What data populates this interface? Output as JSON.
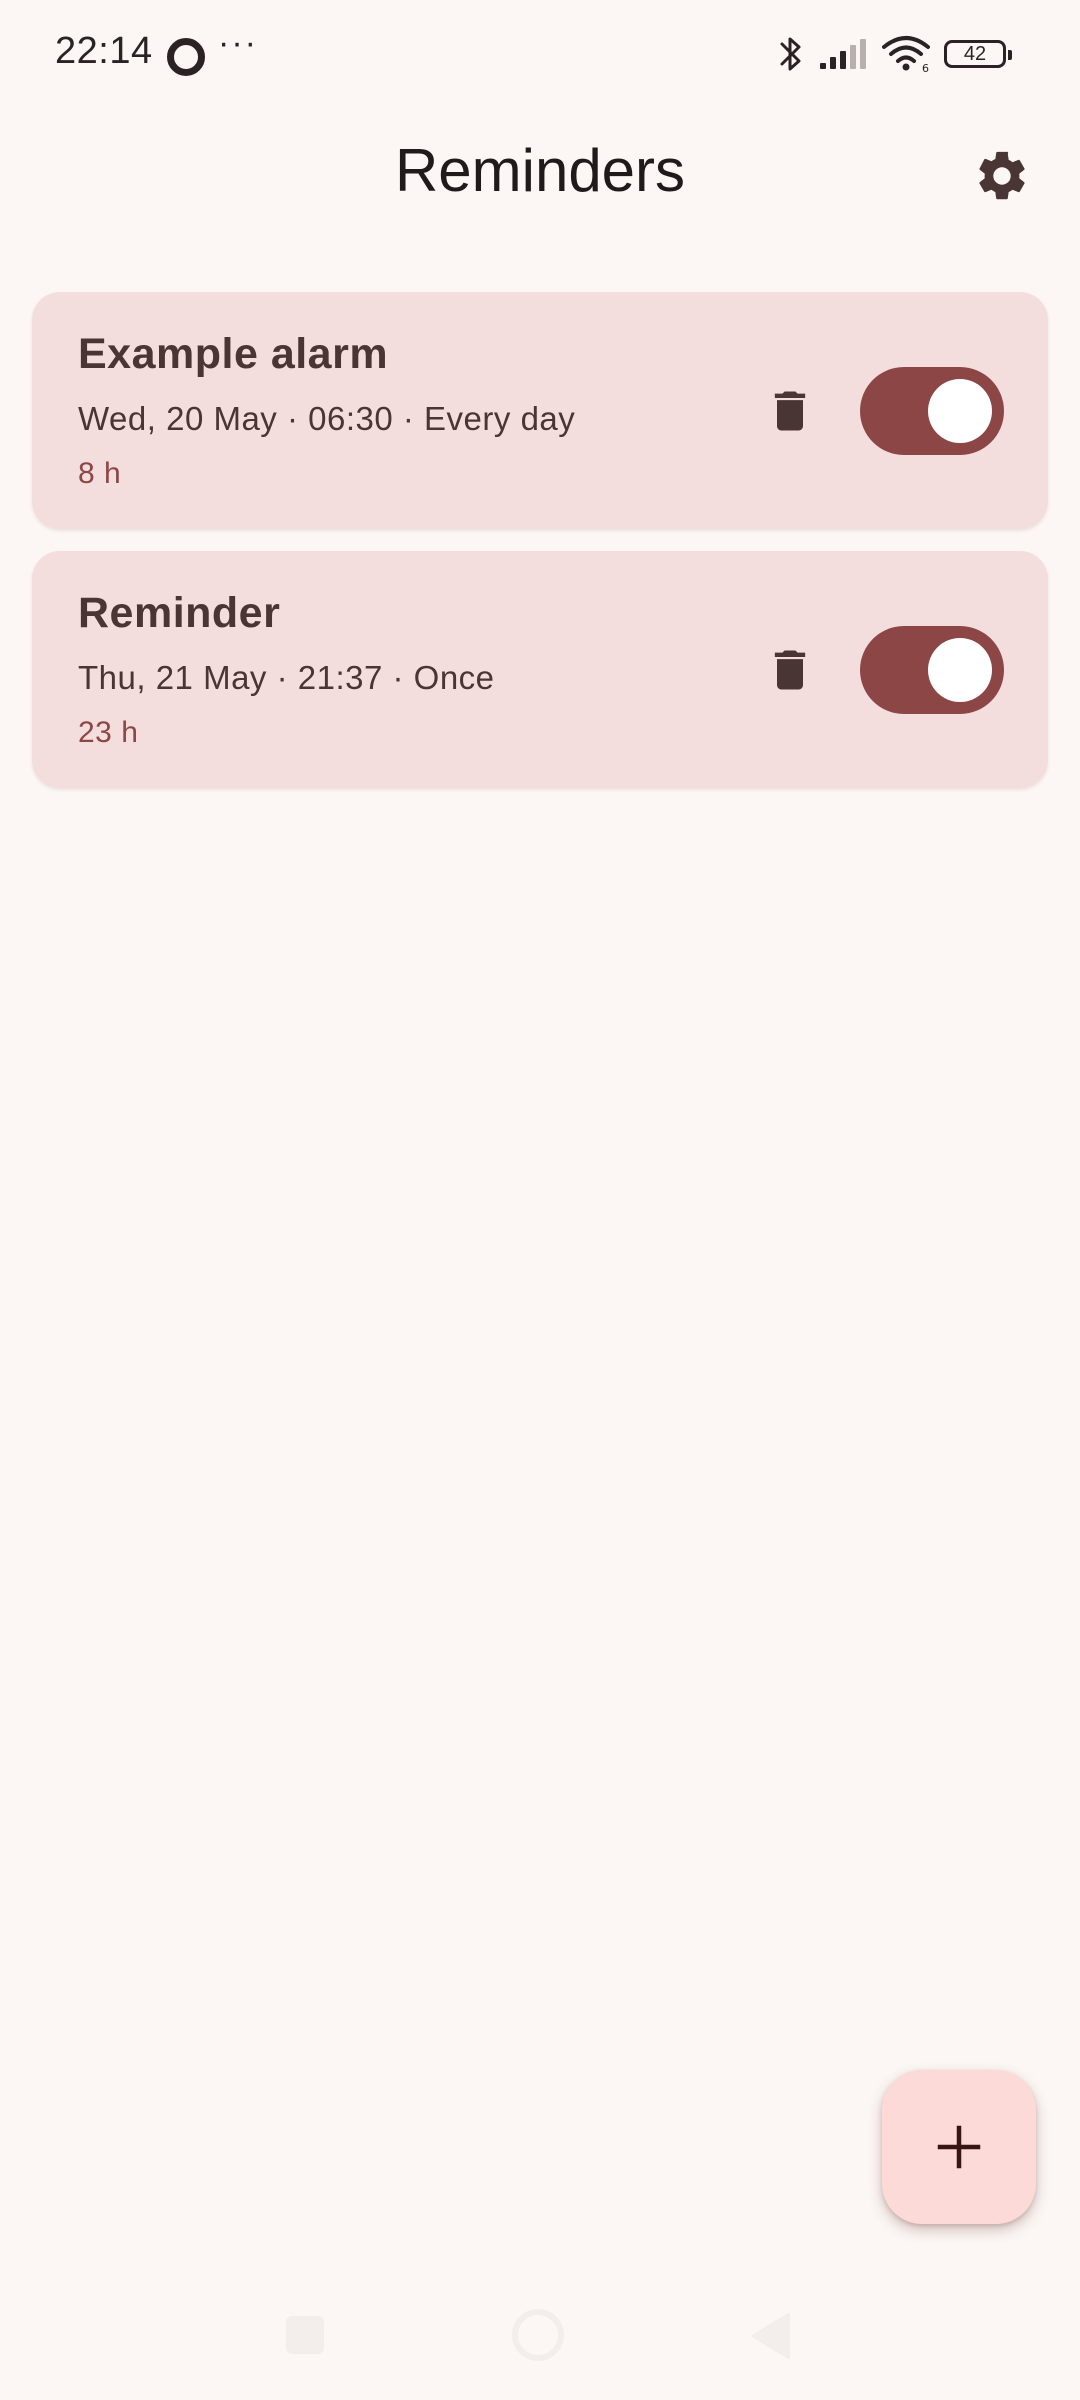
{
  "status_bar": {
    "time": "22:14",
    "dots": "···",
    "battery": "42",
    "icons": [
      "bluetooth-icon",
      "signal-icon",
      "wifi-icon",
      "battery-icon"
    ]
  },
  "header": {
    "title": "Reminders",
    "settings_icon": "gear-icon"
  },
  "reminders": [
    {
      "title": "Example alarm",
      "detail": "Wed, 20 May · 06:30 · Every day",
      "remaining": "8 h",
      "enabled": true
    },
    {
      "title": "Reminder",
      "detail": "Thu, 21 May · 21:37 · Once",
      "remaining": "23 h",
      "enabled": true
    }
  ],
  "fab": {
    "icon": "plus-icon"
  },
  "colors": {
    "background": "#fcf7f4",
    "card": "#f4dedd",
    "accent": "#8c4646",
    "fab": "#fbdad7"
  }
}
